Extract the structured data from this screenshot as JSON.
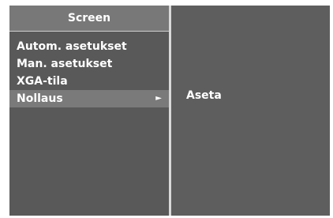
{
  "menu": {
    "title": "Screen",
    "items": [
      {
        "label": "Autom. asetukset"
      },
      {
        "label": "Man. asetukset"
      },
      {
        "label": "XGA-tila"
      },
      {
        "label": "Nollaus",
        "arrow": "►"
      }
    ],
    "selected_index": 3
  },
  "submenu": {
    "items": [
      {
        "label": "Aseta"
      }
    ]
  },
  "colors": {
    "panel_bg": "#595959",
    "header_bg": "#787878",
    "selected_bg": "#7a7a7a",
    "divider": "#d9d9d9",
    "text": "#ffffff"
  },
  "icons": {
    "submenu_arrow": "right-triangle-icon"
  }
}
